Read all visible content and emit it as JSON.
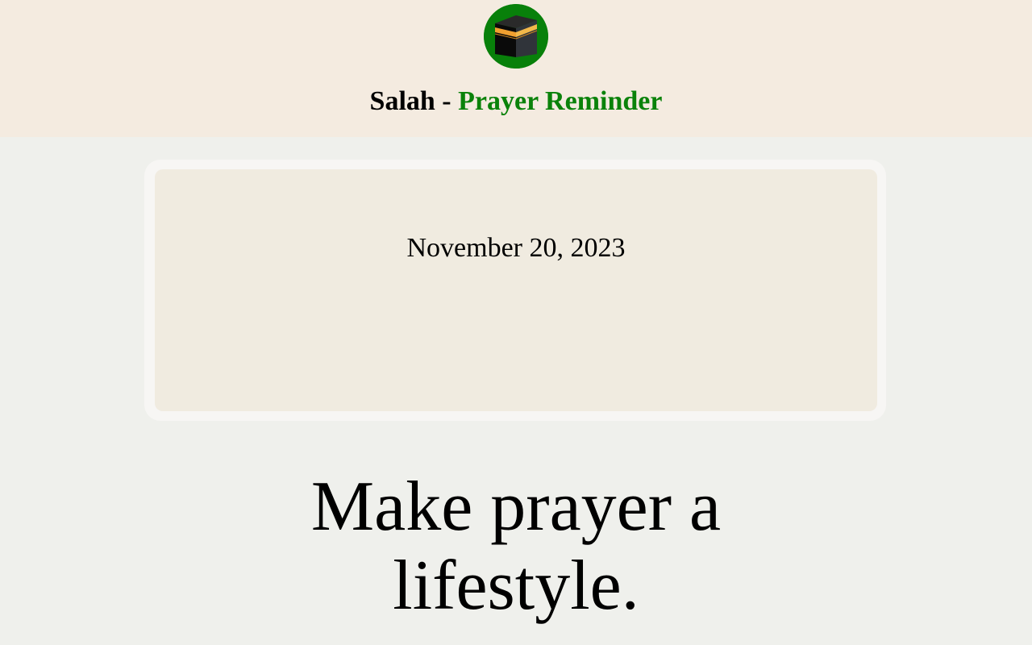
{
  "header": {
    "logo_icon": "kaaba-icon",
    "title_main": "Salah - ",
    "title_accent": "Prayer Reminder",
    "accent_color": "#0a820a",
    "logo_bg_color": "#08800a"
  },
  "card": {
    "date": "November 20, 2023"
  },
  "hero": {
    "tagline": "Make prayer a lifestyle."
  }
}
